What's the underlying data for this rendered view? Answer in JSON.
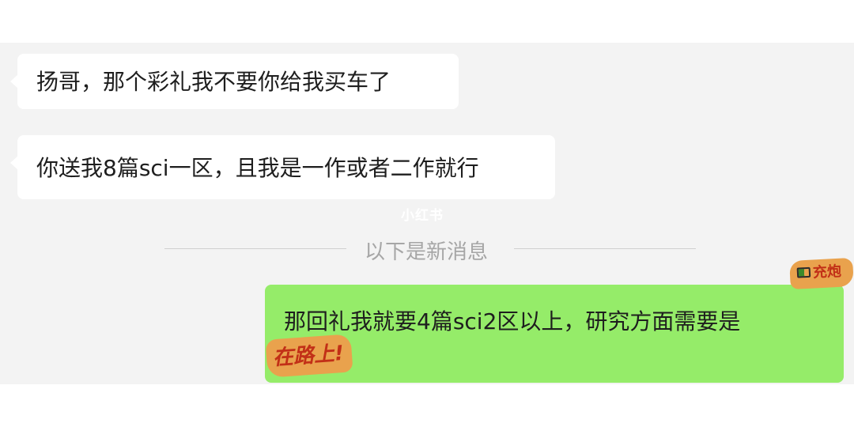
{
  "messages": [
    {
      "direction": "incoming",
      "text": "扬哥，那个彩礼我不要你给我买车了"
    },
    {
      "direction": "incoming",
      "text": "你送我8篇sci一区，且我是一作或者二作就行"
    },
    {
      "direction": "outgoing",
      "text": "那回礼我就要4篇sci2区以上，研究方面需要是"
    }
  ],
  "watermark": "小红书",
  "divider": {
    "text": "以下是新消息"
  },
  "stickers": {
    "charging": "充炮",
    "on_road": "在路上!"
  },
  "colors": {
    "incoming_bubble": "#ffffff",
    "outgoing_bubble": "#95ec69",
    "chat_background": "#f3f3f3",
    "sticker_bg": "#e9a24d",
    "sticker_text": "#c23017"
  }
}
